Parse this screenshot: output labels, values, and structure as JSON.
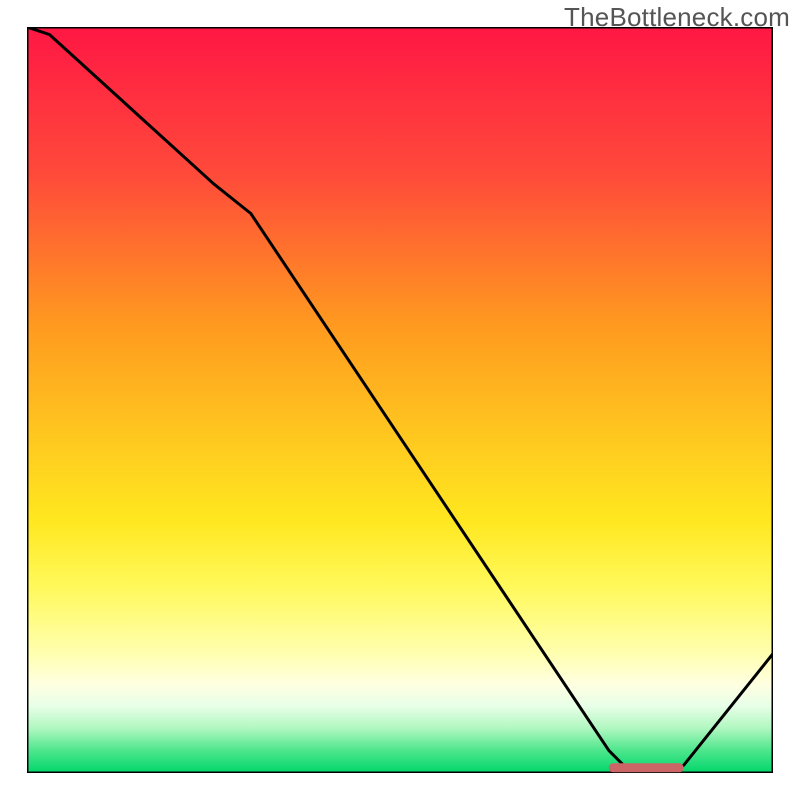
{
  "watermark": "TheBottleneck.com",
  "chart_data": {
    "type": "line",
    "title": "",
    "xlabel": "",
    "ylabel": "",
    "xlim": [
      0,
      100
    ],
    "ylim": [
      0,
      100
    ],
    "grid": false,
    "legend": false,
    "x": [
      0,
      3,
      25,
      30,
      78,
      80,
      83,
      86,
      88,
      100
    ],
    "values": [
      100,
      99,
      79,
      75,
      3,
      1,
      0,
      0,
      1,
      16
    ],
    "marker": {
      "x_start": 78,
      "x_end": 88,
      "y": 0.7,
      "color": "#cc6666"
    },
    "background_gradient": {
      "stops": [
        {
          "offset": 0,
          "color": "#ff1744"
        },
        {
          "offset": 20,
          "color": "#ff4b3a"
        },
        {
          "offset": 40,
          "color": "#ff9a1f"
        },
        {
          "offset": 55,
          "color": "#ffc81f"
        },
        {
          "offset": 66,
          "color": "#ffe71f"
        },
        {
          "offset": 75,
          "color": "#fff95a"
        },
        {
          "offset": 84,
          "color": "#ffffb0"
        },
        {
          "offset": 88,
          "color": "#ffffe0"
        },
        {
          "offset": 91,
          "color": "#e8ffe8"
        },
        {
          "offset": 94,
          "color": "#b0f7c0"
        },
        {
          "offset": 97,
          "color": "#4de68c"
        },
        {
          "offset": 100,
          "color": "#00d66b"
        }
      ]
    },
    "axis_color": "#000000"
  }
}
